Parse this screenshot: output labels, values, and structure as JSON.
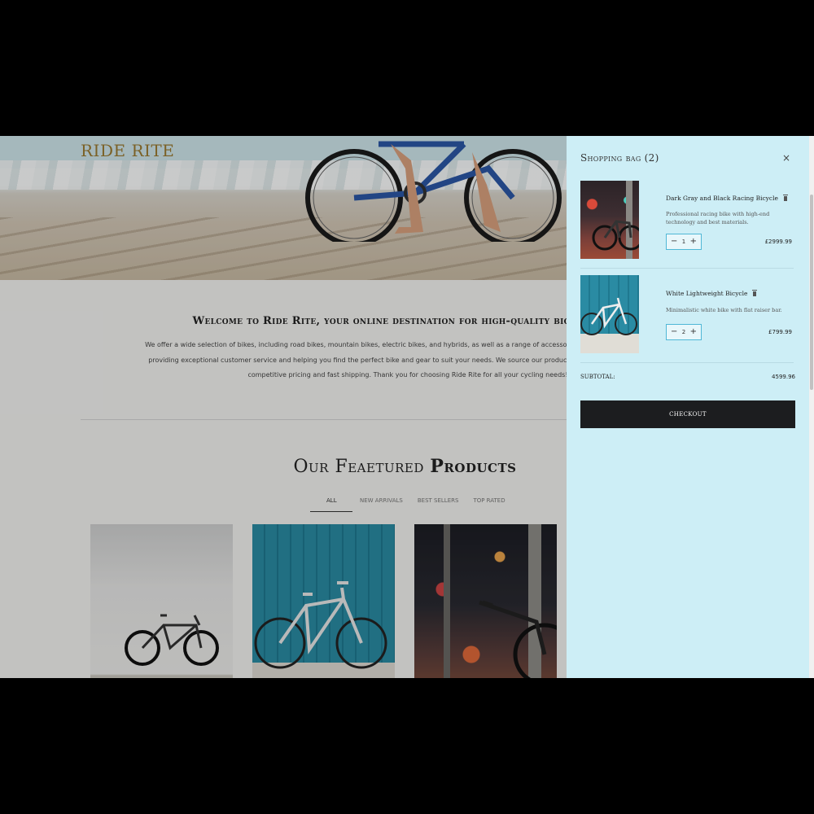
{
  "brand": "RIDE RITE",
  "welcome": {
    "heading": "Welcome to Ride Rite, your online destination for high-quality bicycles and",
    "lines": [
      "We offer a wide selection of bikes, including road bikes, mountain bikes, electric bikes, and hybrids, as well as a range of accessories such as helmets, locks, ligh",
      "providing exceptional customer service and helping you find the perfect bike and gear to suit your needs. We source our products from top manufacturers to e",
      "competitive pricing and fast shipping. Thank you for choosing Ride Rite for all your cycling needs!"
    ]
  },
  "featured": {
    "title_part1": "Our Feaetured",
    "title_part2": "Products",
    "tabs": [
      "ALL",
      "NEW ARRIVALS",
      "BEST SELLERS",
      "TOP RATED"
    ],
    "active_tab": "ALL"
  },
  "bag": {
    "title": "Shopping bag (2)",
    "close_icon": "×",
    "items": [
      {
        "name": "Dark Gray and Black Racing Bicycle",
        "description": "Professional racing bike with high-end technology and best materials.",
        "quantity": "1",
        "price": "£2999.99"
      },
      {
        "name": "White Lightweight Bicycle",
        "description": "Minimalistic white bike with flat raiser bar.",
        "quantity": "2",
        "price": "£799.99"
      }
    ],
    "minus": "−",
    "plus": "+",
    "subtotal_label": "SUBTOTAL:",
    "subtotal_value": "4599.96",
    "checkout_label": "CHECKOUT"
  },
  "colors": {
    "drawer_bg": "#cdeef6",
    "brand": "#9a7a30",
    "checkout_bg": "#1c1d1f",
    "qty_border": "#4fb7d6"
  }
}
